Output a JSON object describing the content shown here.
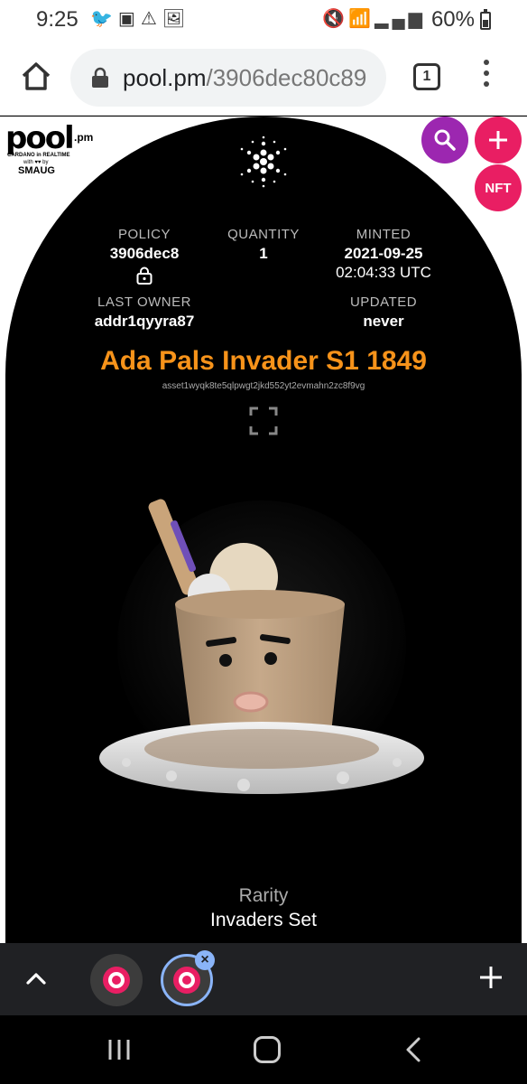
{
  "status_bar": {
    "time": "9:25",
    "left_icons": [
      "twitter-icon",
      "twitch-icon",
      "alert-icon",
      "image-icon"
    ],
    "right_icons": [
      "mute-icon",
      "wifi-icon",
      "signal-icon"
    ],
    "battery_text": "60%",
    "battery_level": 0.6
  },
  "browser": {
    "url_domain": "pool.pm",
    "url_path": "/3906dec80c89",
    "tab_count": "1"
  },
  "site": {
    "logo_text": "pool",
    "logo_suffix": ".pm",
    "logo_tagline": "CARDANO in REALTIME",
    "logo_with": "with ♥♥ by",
    "logo_partner": "SMAUG",
    "fab_nft_label": "NFT"
  },
  "asset": {
    "policy_label": "POLICY",
    "policy_value": "3906dec8",
    "quantity_label": "QUANTITY",
    "quantity_value": "1",
    "minted_label": "MINTED",
    "minted_date": "2021-09-25",
    "minted_time": "02:04:33 UTC",
    "owner_label": "LAST OWNER",
    "owner_value": "addr1qyyra87",
    "updated_label": "UPDATED",
    "updated_value": "never",
    "title": "Ada Pals Invader S1 1849",
    "asset_id": "asset1wyqk8te5qlpwgt2jkd552yt2evmahn2zc8f9vg",
    "rarity_label": "Rarity",
    "rarity_value": "Invaders Set"
  },
  "colors": {
    "title_orange": "#f7931a",
    "fab_purple": "#9c27b0",
    "fab_pink": "#e91e63",
    "tab_highlight": "#8ab4f8"
  }
}
